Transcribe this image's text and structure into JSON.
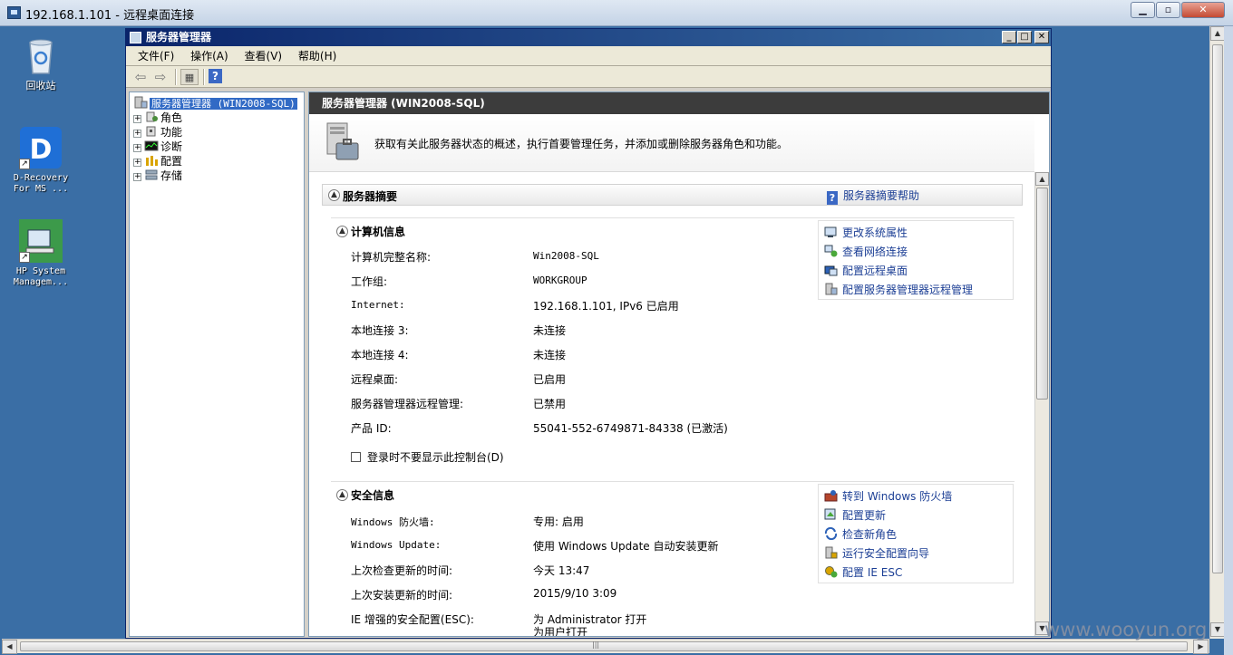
{
  "rdp": {
    "title": "192.168.1.101 - 远程桌面连接",
    "min": "▁",
    "max": "▫",
    "close": "✕"
  },
  "desktop": {
    "icons": [
      {
        "label": "回收站"
      },
      {
        "label": "D-Recovery For MS ..."
      },
      {
        "label": "HP System Managem..."
      }
    ]
  },
  "window": {
    "title": "服务器管理器",
    "controls": {
      "min": "_",
      "max": "□",
      "close": "✕"
    }
  },
  "menubar": {
    "file": "文件(F)",
    "action": "操作(A)",
    "view": "查看(V)",
    "help": "帮助(H)"
  },
  "toolbar": {
    "back": "⇦",
    "forward": "⇨",
    "view": "▦",
    "help": "?"
  },
  "tree": {
    "root": "服务器管理器 (WIN2008-SQL)",
    "items": [
      "角色",
      "功能",
      "诊断",
      "配置",
      "存储"
    ]
  },
  "content": {
    "header": "服务器管理器 (WIN2008-SQL)",
    "intro": "获取有关此服务器状态的概述，执行首要管理任务，并添加或删除服务器角色和功能。",
    "summary_title": "服务器摘要",
    "summary_help": "服务器摘要帮助",
    "computer_info": {
      "title": "计算机信息",
      "rows": [
        {
          "label": "计算机完整名称:",
          "value": "Win2008-SQL"
        },
        {
          "label": "工作组:",
          "value": "WORKGROUP"
        },
        {
          "label": "Internet:",
          "value": "192.168.1.101, IPv6 已启用"
        },
        {
          "label": "本地连接 3:",
          "value": "未连接"
        },
        {
          "label": "本地连接 4:",
          "value": "未连接"
        },
        {
          "label": "远程桌面:",
          "value": "已启用"
        },
        {
          "label": "服务器管理器远程管理:",
          "value": "已禁用"
        },
        {
          "label": "产品 ID:",
          "value": "55041-552-6749871-84338 (已激活)"
        }
      ],
      "checkbox": "登录时不要显示此控制台(D)",
      "tasks": [
        "更改系统属性",
        "查看网络连接",
        "配置远程桌面",
        "配置服务器管理器远程管理"
      ]
    },
    "security_info": {
      "title": "安全信息",
      "rows": [
        {
          "label": "Windows 防火墙:",
          "value": "专用: 启用"
        },
        {
          "label": "Windows Update:",
          "value": "使用 Windows Update 自动安装更新"
        },
        {
          "label": "上次检查更新的时间:",
          "value": "今天 13:47"
        },
        {
          "label": "上次安装更新的时间:",
          "value": "2015/9/10 3:09"
        },
        {
          "label": "IE 增强的安全配置(ESC):",
          "value": "为 Administrator 打开"
        }
      ],
      "ie_extra": "为用户打开",
      "tasks": [
        "转到 Windows 防火墙",
        "配置更新",
        "检查新角色",
        "运行安全配置向导",
        "配置 IE ESC"
      ]
    }
  },
  "scroll": {
    "up": "▲",
    "down": "▼",
    "left": "◀",
    "right": "▶",
    "grip": "|||"
  },
  "watermark": "www.wooyun.org"
}
